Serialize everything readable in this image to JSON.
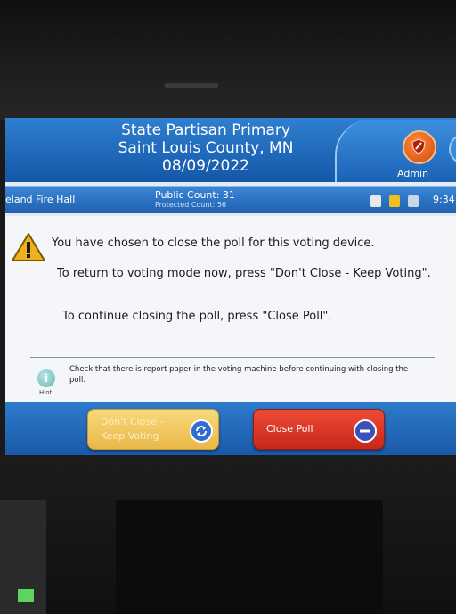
{
  "header": {
    "title_line1": "State Partisan Primary",
    "title_line2": "Saint Louis County, MN",
    "date": "08/09/2022",
    "admin_label": "Admin",
    "admin_icon": "shield-icon"
  },
  "info_bar": {
    "location": "eland Fire Hall",
    "public_count": "Public Count: 31",
    "protected_count": "Protected Count: 56",
    "time": "9:34",
    "status_icons": [
      "printer-icon",
      "battery-icon",
      "network-icon"
    ]
  },
  "dialog": {
    "message_main": "You have chosen to close the poll for this voting device.",
    "message_return": "To return to voting mode now, press \"Don't Close - Keep Voting\".",
    "message_continue": "To continue closing the poll, press \"Close Poll\".",
    "hint_label": "Hint",
    "hint_text": "Check that there is report paper in the voting machine before continuing with closing the poll."
  },
  "buttons": {
    "dont_close_line1": "Don't Close -",
    "dont_close_line2": "Keep Voting",
    "close_poll": "Close Poll"
  },
  "colors": {
    "header_blue": "#1457a8",
    "dont_close_yellow": "#eab84a",
    "close_poll_red": "#c7271a",
    "warning_yellow": "#f2b01e"
  }
}
